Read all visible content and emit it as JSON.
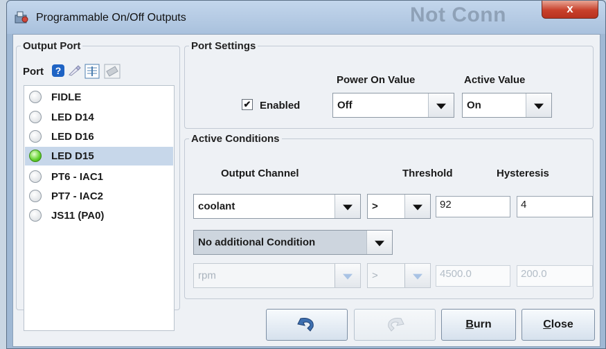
{
  "window": {
    "title": "Programmable On/Off Outputs",
    "background_text": "Not Conn",
    "close_glyph": "x"
  },
  "output_port": {
    "title": "Output Port",
    "port_label": "Port",
    "icons": [
      "help-icon",
      "edit-icon",
      "table-icon",
      "chip-icon"
    ],
    "ports": [
      {
        "label": "FIDLE",
        "selected": false
      },
      {
        "label": "LED D14",
        "selected": false
      },
      {
        "label": "LED D16",
        "selected": false
      },
      {
        "label": "LED D15",
        "selected": true
      },
      {
        "label": "PT6 - IAC1",
        "selected": false
      },
      {
        "label": "PT7 - IAC2",
        "selected": false
      },
      {
        "label": "JS11 (PA0)",
        "selected": false
      }
    ]
  },
  "port_settings": {
    "title": "Port Settings",
    "power_on_label": "Power On Value",
    "active_value_label": "Active Value",
    "enabled_label": "Enabled",
    "enabled_checked": true,
    "power_on_value": "Off",
    "active_value": "On"
  },
  "active_conditions": {
    "title": "Active Conditions",
    "col_output": "Output Channel",
    "col_threshold": "Threshold",
    "col_hysteresis": "Hysteresis",
    "condition1": {
      "channel": "coolant",
      "operator": ">",
      "threshold": "92",
      "hysteresis": "4"
    },
    "additional_condition": "No additional Condition",
    "condition2": {
      "channel": "rpm",
      "operator": ">",
      "threshold": "4500.0",
      "hysteresis": "200.0",
      "enabled": false
    }
  },
  "buttons": {
    "undo": "undo-icon",
    "redo": "redo-icon",
    "burn_mnemonic": "B",
    "burn_rest": "urn",
    "close_mnemonic": "C",
    "close_rest": "lose"
  },
  "colors": {
    "title_bar": "#b4c9e3",
    "selected_row": "#c7d7ea",
    "led_on": "#5fcf2a",
    "close_button": "#c8402b"
  }
}
